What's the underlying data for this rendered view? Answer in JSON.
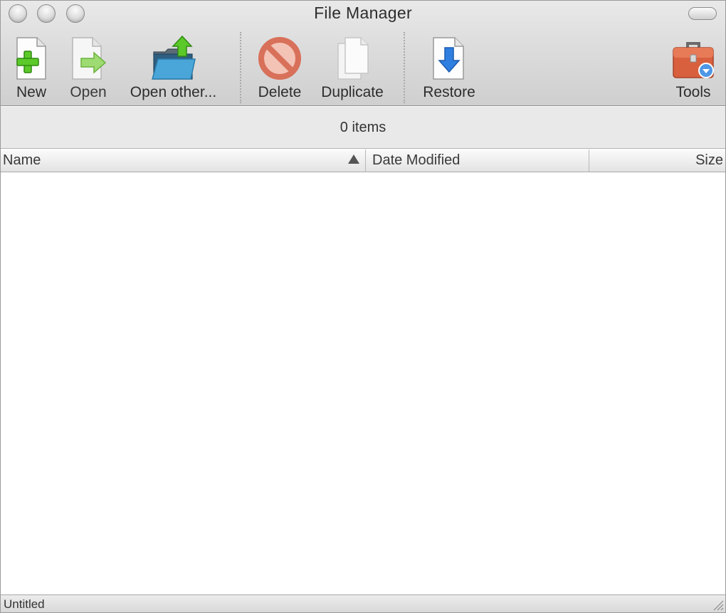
{
  "window": {
    "title": "File Manager"
  },
  "toolbar": {
    "items": [
      {
        "label": "New",
        "icon": "new-document-icon"
      },
      {
        "label": "Open",
        "icon": "open-document-icon"
      },
      {
        "label": "Open other...",
        "icon": "open-folder-icon"
      },
      {
        "label": "Delete",
        "icon": "delete-icon"
      },
      {
        "label": "Duplicate",
        "icon": "duplicate-icon"
      },
      {
        "label": "Restore",
        "icon": "restore-icon"
      },
      {
        "label": "Tools",
        "icon": "toolbox-icon"
      }
    ]
  },
  "status": {
    "item_count": "0 items"
  },
  "table": {
    "columns": [
      "Name",
      "Date Modified",
      "Size"
    ],
    "sort_column": "Name",
    "sort_direction": "ascending",
    "rows": []
  },
  "footer": {
    "label": "Untitled"
  },
  "colors": {
    "accent_green": "#5cc92a",
    "delete_red": "#e07a63",
    "restore_blue": "#2f7fe0",
    "folder_blue": "#4aa6d8",
    "toolbox_orange": "#d8603e"
  }
}
